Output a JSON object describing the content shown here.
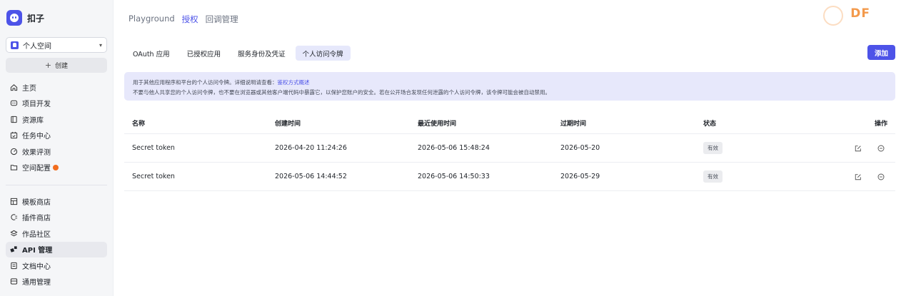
{
  "brand": {
    "name": "扣子"
  },
  "space_select": {
    "label": "个人空间"
  },
  "create": {
    "label": "创建"
  },
  "nav_main": [
    {
      "label": "主页",
      "icon": "home-icon"
    },
    {
      "label": "项目开发",
      "icon": "project-icon"
    },
    {
      "label": "资源库",
      "icon": "library-icon"
    },
    {
      "label": "任务中心",
      "icon": "task-icon"
    },
    {
      "label": "效果评测",
      "icon": "evaluate-icon"
    },
    {
      "label": "空间配置",
      "icon": "space-config-icon",
      "badge": true
    }
  ],
  "nav_secondary": [
    {
      "label": "模板商店",
      "icon": "template-store-icon"
    },
    {
      "label": "插件商店",
      "icon": "plugin-store-icon"
    },
    {
      "label": "作品社区",
      "icon": "community-icon"
    },
    {
      "label": "API 管理",
      "icon": "api-icon",
      "active": true
    },
    {
      "label": "文档中心",
      "icon": "docs-icon"
    },
    {
      "label": "通用管理",
      "icon": "general-settings-icon"
    }
  ],
  "breadcrumb": [
    "Playground",
    "授权",
    "回调管理"
  ],
  "watermark": {
    "text": "DF"
  },
  "tabs": [
    "OAuth 应用",
    "已授权应用",
    "服务身份及凭证",
    "个人访问令牌"
  ],
  "add_button": {
    "label": "添加"
  },
  "info": {
    "line1_prefix": "用于其他应用程序和平台的个人访问令牌。详细说明请查看：",
    "line1_link": "鉴权方式概述",
    "line2": "不要与他人共享您的个人访问令牌，也不要在浏览器或其他客户端代码中暴露它，以保护您账户的安全。若在公开场合发现任何泄露的个人访问令牌，该令牌可能会被自动禁用。"
  },
  "table": {
    "headers": [
      "名称",
      "创建时间",
      "最近使用时间",
      "过期时间",
      "状态",
      "操作"
    ],
    "rows": [
      {
        "name": "Secret token",
        "created": "2026-04-20 11:24:26",
        "last_used": "2026-05-06 15:48:24",
        "expires": "2026-05-20",
        "status": "有效"
      },
      {
        "name": "Secret token",
        "created": "2026-05-06 14:44:52",
        "last_used": "2026-05-06 14:50:33",
        "expires": "2026-05-29",
        "status": "有效"
      }
    ]
  },
  "colors": {
    "accent": "#4d53e8",
    "badge": "#f26d1f",
    "info_bg": "#e7e8fb"
  }
}
